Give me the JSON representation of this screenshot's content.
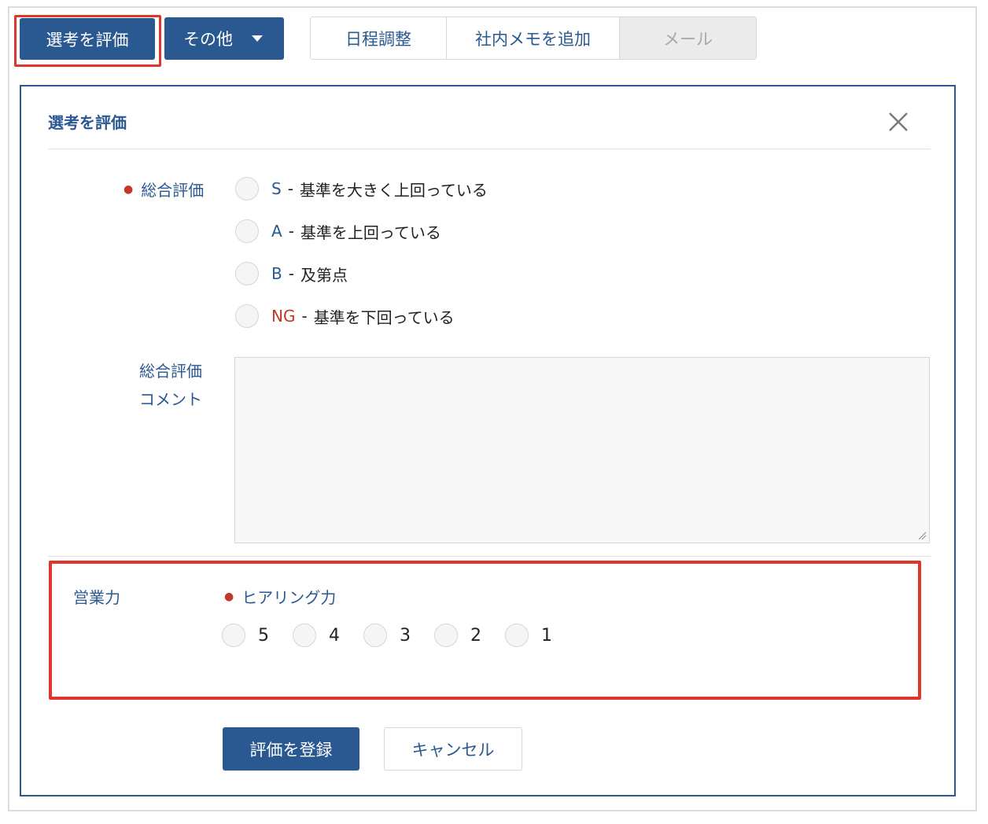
{
  "toolbar": {
    "evaluate_label": "選考を評価",
    "more_label": "その他",
    "tabs": [
      {
        "label": "日程調整",
        "enabled": true
      },
      {
        "label": "社内メモを追加",
        "enabled": true
      },
      {
        "label": "メール",
        "enabled": false
      }
    ]
  },
  "panel": {
    "title": "選考を評価",
    "overall": {
      "label": "総合評価",
      "options": [
        {
          "grade": "S",
          "separator": "-",
          "description": "基準を大きく上回っている"
        },
        {
          "grade": "A",
          "separator": "-",
          "description": "基準を上回っている"
        },
        {
          "grade": "B",
          "separator": "-",
          "description": "及第点"
        },
        {
          "grade": "NG",
          "separator": "-",
          "description": "基準を下回っている"
        }
      ]
    },
    "comment": {
      "label_line1": "総合評価",
      "label_line2": "コメント",
      "value": ""
    },
    "sales": {
      "category": "営業力",
      "criterion": "ヒアリング力",
      "scores": [
        "5",
        "4",
        "3",
        "2",
        "1"
      ]
    },
    "submit_label": "評価を登録",
    "cancel_label": "キャンセル"
  },
  "colors": {
    "primary": "#2a5891",
    "required_dot": "#c0392b",
    "highlight": "#e0352b",
    "ng": "#c0392b"
  }
}
